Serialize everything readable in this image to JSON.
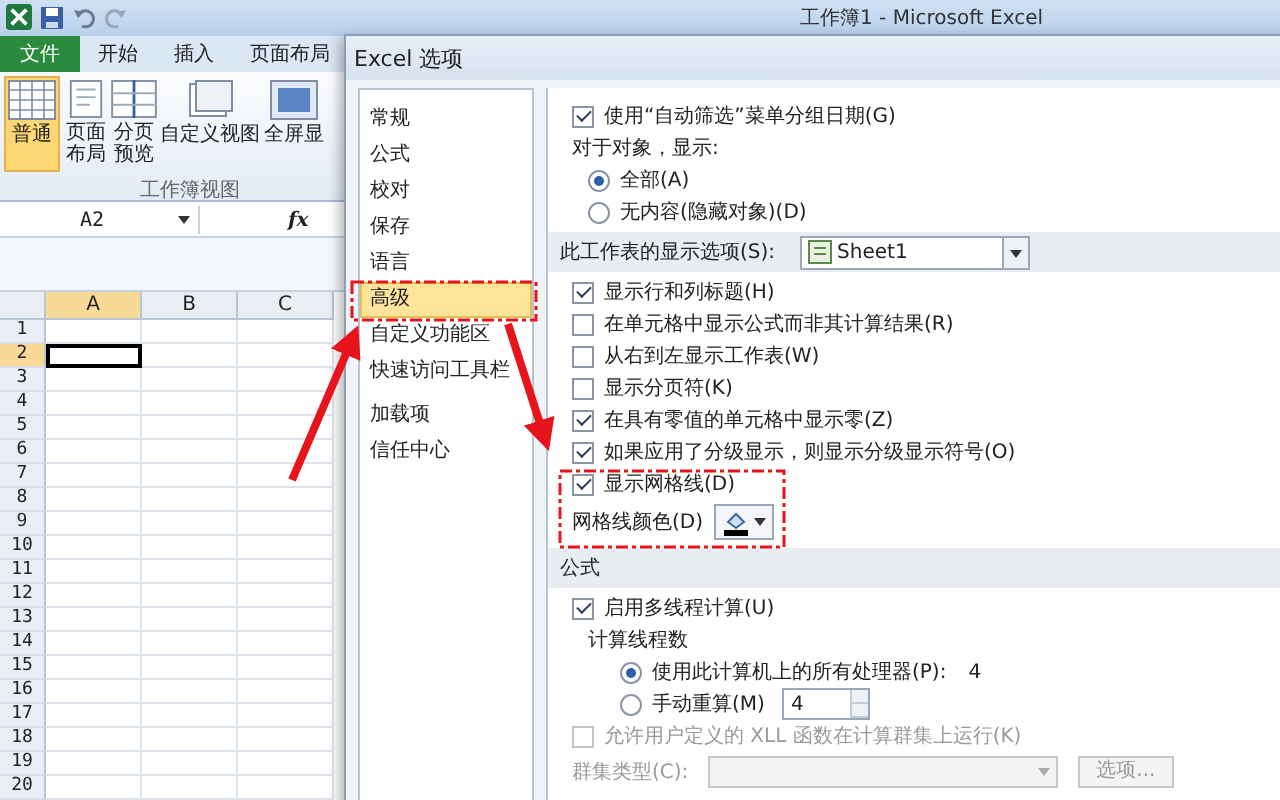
{
  "excel": {
    "title": "工作簿1 - Microsoft Excel",
    "tabs": [
      {
        "label": "文件",
        "kind": "file",
        "selected": false
      },
      {
        "label": "开始",
        "kind": "tab",
        "selected": false
      },
      {
        "label": "插入",
        "kind": "tab",
        "selected": false
      },
      {
        "label": "页面布局",
        "kind": "tab",
        "selected": false
      }
    ],
    "ribbon": {
      "buttons": [
        {
          "label": "普通",
          "kind": "grid",
          "selected": true
        },
        {
          "label": "页面布局",
          "kind": "page",
          "selected": false
        },
        {
          "label": "分页预览",
          "kind": "split",
          "selected": false
        },
        {
          "label": "自定义视图",
          "kind": "custom",
          "selected": false
        },
        {
          "label": "全屏显",
          "kind": "full",
          "selected": false
        }
      ],
      "group_label": "工作簿视图"
    },
    "name_box": "A2",
    "function_label": "fx",
    "grid": {
      "columns": [
        {
          "label": "A",
          "selected": true
        },
        {
          "label": "B",
          "selected": false
        },
        {
          "label": "C",
          "selected": false
        }
      ],
      "rows": [
        {
          "label": "1",
          "selected": false
        },
        {
          "label": "2",
          "selected": true
        },
        {
          "label": "3",
          "selected": false
        },
        {
          "label": "4",
          "selected": false
        },
        {
          "label": "5",
          "selected": false
        },
        {
          "label": "6",
          "selected": false
        },
        {
          "label": "7",
          "selected": false
        },
        {
          "label": "8",
          "selected": false
        },
        {
          "label": "9",
          "selected": false
        },
        {
          "label": "10",
          "selected": false
        },
        {
          "label": "11",
          "selected": false
        },
        {
          "label": "12",
          "selected": false
        },
        {
          "label": "13",
          "selected": false
        },
        {
          "label": "14",
          "selected": false
        },
        {
          "label": "15",
          "selected": false
        },
        {
          "label": "16",
          "selected": false
        },
        {
          "label": "17",
          "selected": false
        },
        {
          "label": "18",
          "selected": false
        },
        {
          "label": "19",
          "selected": false
        },
        {
          "label": "20",
          "selected": false
        }
      ]
    }
  },
  "dialog": {
    "title": "Excel 选项",
    "nav": [
      {
        "label": "常规",
        "selected": false
      },
      {
        "label": "公式",
        "selected": false
      },
      {
        "label": "校对",
        "selected": false
      },
      {
        "label": "保存",
        "selected": false
      },
      {
        "label": "语言",
        "selected": false
      },
      {
        "label": "高级",
        "selected": true
      },
      {
        "label": "自定义功能区",
        "selected": false
      },
      {
        "label": "快速访问工具栏",
        "selected": false
      },
      {
        "label": "加载项",
        "selected": false
      },
      {
        "label": "信任中心",
        "selected": false
      }
    ],
    "options": [
      {
        "kind": "checkbox",
        "label": "使用“自动筛选”菜单分组日期(G)",
        "checked": true,
        "disabled": false
      },
      {
        "kind": "text",
        "label": "对于对象，显示:",
        "children": [
          {
            "kind": "radio",
            "label": "全部(A)",
            "selected": true
          },
          {
            "kind": "radio",
            "label": "无内容(隐藏对象)(D)",
            "selected": false
          }
        ]
      },
      {
        "kind": "header",
        "label": "此工作表的显示选项(S):",
        "dropdown": "Sheet1"
      },
      {
        "kind": "checkbox",
        "label": "显示行和列标题(H)",
        "checked": true,
        "disabled": false
      },
      {
        "kind": "checkbox",
        "label": "在单元格中显示公式而非其计算结果(R)",
        "checked": false,
        "disabled": false
      },
      {
        "kind": "checkbox",
        "label": "从右到左显示工作表(W)",
        "checked": false,
        "disabled": false
      },
      {
        "kind": "checkbox",
        "label": "显示分页符(K)",
        "checked": false,
        "disabled": false
      },
      {
        "kind": "checkbox",
        "label": "在具有零值的单元格中显示零(Z)",
        "checked": true,
        "disabled": false
      },
      {
        "kind": "checkbox",
        "label": "如果应用了分级显示，则显示分级显示符号(O)",
        "checked": true,
        "disabled": false
      },
      {
        "kind": "checkbox",
        "label": "显示网格线(D)",
        "checked": true,
        "disabled": false
      },
      {
        "kind": "color",
        "label": "网格线颜色(D)"
      },
      {
        "kind": "header",
        "label": "公式"
      },
      {
        "kind": "checkbox",
        "label": "启用多线程计算(U)",
        "checked": true,
        "disabled": false,
        "children": [
          {
            "kind": "text",
            "label": "计算线程数",
            "children": [
              {
                "kind": "radio",
                "label": "使用此计算机上的所有处理器(P):",
                "value": "4",
                "selected": true
              },
              {
                "kind": "radio",
                "label": "手动重算(M)",
                "spin": "4",
                "selected": false
              }
            ]
          }
        ]
      },
      {
        "kind": "checkbox",
        "label": "允许用户定义的 XLL 函数在计算群集上运行(K)",
        "checked": false,
        "disabled": true
      },
      {
        "kind": "select",
        "label": "群集类型(C):",
        "button": "选项...",
        "disabled": true
      }
    ]
  }
}
